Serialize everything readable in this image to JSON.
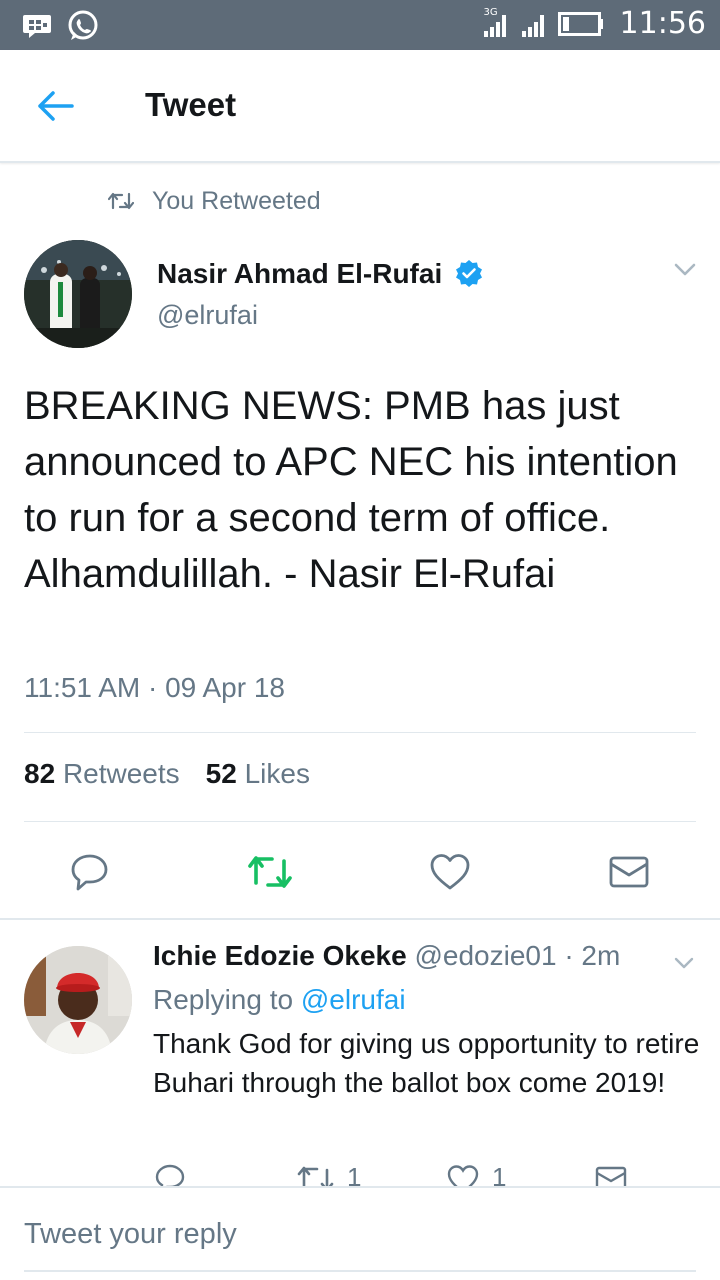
{
  "status_bar": {
    "time": "11:56",
    "network": "3G",
    "icons": [
      "bbm-icon",
      "whatsapp-icon",
      "signal-icon",
      "signal-icon",
      "battery-icon"
    ]
  },
  "header": {
    "title": "Tweet",
    "back_icon": "arrow-left-icon"
  },
  "retweet_context": {
    "label": "You Retweeted"
  },
  "tweet": {
    "author_name": "Nasir Ahmad El-Rufai",
    "author_handle": "@elrufai",
    "verified": true,
    "text": "BREAKING NEWS: PMB has just announced to APC NEC his intention to run for a second term of office. Alhamdulillah. - Nasir El-Rufai",
    "timestamp": "11:51 AM · 09 Apr 18",
    "retweet_count": "82",
    "retweet_label": "Retweets",
    "like_count": "52",
    "like_label": "Likes"
  },
  "reply": {
    "author_name": "Ichie Edozie Okeke",
    "author_handle": "@edozie01",
    "age": "· 2m",
    "replying_prefix": "Replying to",
    "replying_to": "@elrufai",
    "text": "Thank God for giving us opportunity to retire Buhari through the ballot box come 2019!",
    "retweet_count": "1",
    "like_count": "1"
  },
  "compose": {
    "placeholder": "Tweet your reply"
  },
  "colors": {
    "status_bar": "#5e6b78",
    "accent": "#1da1f2",
    "retweet_active": "#17bf63",
    "secondary_text": "#657786",
    "primary_text": "#14171a",
    "divider": "#e1e8ed"
  }
}
